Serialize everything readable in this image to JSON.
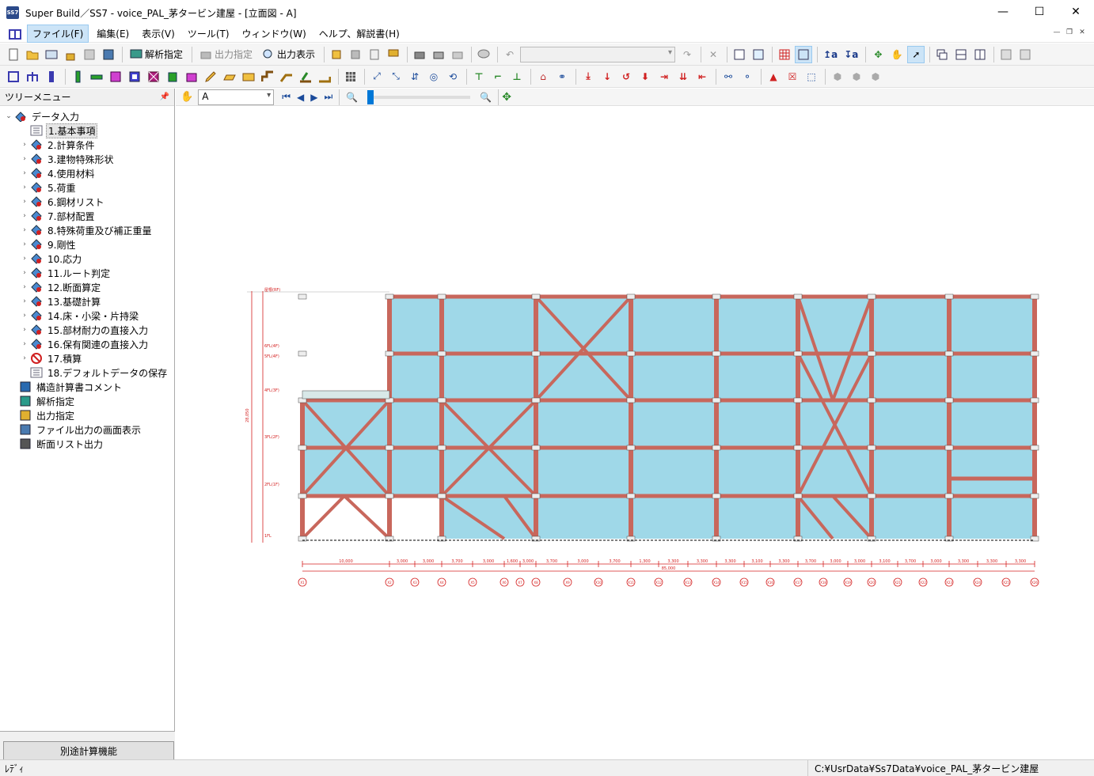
{
  "window": {
    "title": "Super Build／SS7 - voice_PAL_茅タービン建屋 - [立面図 - A]",
    "app_icon_text": "SS7"
  },
  "menu": {
    "items": [
      {
        "label": "ファイル(F)",
        "active": true
      },
      {
        "label": "編集(E)"
      },
      {
        "label": "表示(V)"
      },
      {
        "label": "ツール(T)"
      },
      {
        "label": "ウィンドウ(W)"
      },
      {
        "label": "ヘルプ、解説書(H)"
      }
    ]
  },
  "toolbar": {
    "analysis_label": "解析指定",
    "output_spec_label": "出力指定",
    "output_view_label": "出力表示"
  },
  "tree_panel": {
    "title": "ツリーメニュー",
    "root": "データ入力",
    "data_items": [
      "1.基本事項",
      "2.計算条件",
      "3.建物特殊形状",
      "4.使用材料",
      "5.荷重",
      "6.鋼材リスト",
      "7.部材配置",
      "8.特殊荷重及び補正重量",
      "9.剛性",
      "10.応力",
      "11.ルート判定",
      "12.断面算定",
      "13.基礎計算",
      "14.床・小梁・片持梁",
      "15.部材耐力の直接入力",
      "16.保有関連の直接入力",
      "17.積算",
      "18.デフォルトデータの保存"
    ],
    "top_items": [
      "構造計算書コメント",
      "解析指定",
      "出力指定",
      "ファイル出力の画面表示",
      "断面リスト出力"
    ],
    "footer_button": "別途計算機能"
  },
  "view": {
    "frame_selector": "A"
  },
  "drawing": {
    "total_span": "85,000",
    "spans": [
      "10,000",
      "3,000",
      "3,000",
      "3,700",
      "3,000",
      "1,600",
      "3,000",
      "3,700",
      "3,000",
      "3,700",
      "1,300",
      "3,300",
      "3,300",
      "3,300",
      "3,100",
      "3,300",
      "3,700",
      "3,000",
      "3,000",
      "3,100",
      "3,700",
      "3,000",
      "3,300",
      "3,300",
      "3,300"
    ],
    "axis_labels": [
      "X1",
      "X2",
      "X3",
      "X4",
      "X5",
      "X6",
      "X7",
      "X8",
      "X9",
      "X10",
      "X11",
      "X12",
      "X13",
      "X14",
      "X15",
      "X16",
      "X17",
      "X18",
      "X19",
      "X20",
      "X21",
      "X22",
      "X23",
      "X24",
      "X25",
      "X26",
      "X27"
    ],
    "level_labels": [
      "屋根(RF)",
      "6FL(4F)",
      "5FL(4F)",
      "4FL(3F)",
      "3FL(2F)",
      "2FL(1F)",
      "1FL"
    ],
    "total_height": "28,050",
    "colors": {
      "panel": "#9fd8e8",
      "member": "#c8675c",
      "dim": "#d42020"
    }
  },
  "status": {
    "left": "ﾚﾃﾞｨ",
    "path": "C:¥UsrData¥Ss7Data¥voice_PAL_茅タービン建屋"
  }
}
